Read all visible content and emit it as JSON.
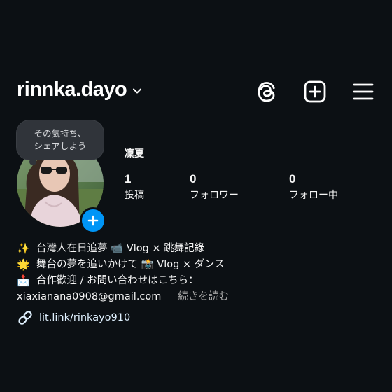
{
  "header": {
    "username": "rinnka.dayo",
    "icons": [
      "chevron-down-icon",
      "threads-icon",
      "new-post-icon",
      "menu-icon"
    ]
  },
  "note_bubble": {
    "line1": "その気持ち、",
    "line2": "シェアしよう"
  },
  "profile": {
    "display_name": "凜夏",
    "stats": [
      {
        "value": "1",
        "label": "投稿"
      },
      {
        "value": "0",
        "label": "フォロワー"
      },
      {
        "value": "0",
        "label": "フォロー中"
      }
    ]
  },
  "bio": {
    "lines": [
      {
        "emoji": "✨",
        "text": "台灣人在日追夢 📹 Vlog × 跳舞記錄"
      },
      {
        "emoji": "🌟",
        "text": "舞台の夢を追いかけて 📸 Vlog × ダンス"
      },
      {
        "emoji": "📩",
        "text": "合作歡迎 / お問い合わせはこちら："
      }
    ],
    "email": "xiaxianana0908@gmail.com",
    "more_label": "続きを読む"
  },
  "link": {
    "text": "lit.link/rinkayo910"
  },
  "colors": {
    "background": "#0c1014",
    "accent": "#0095f6",
    "link": "#e0f1ff",
    "muted": "#a8a8a8"
  }
}
